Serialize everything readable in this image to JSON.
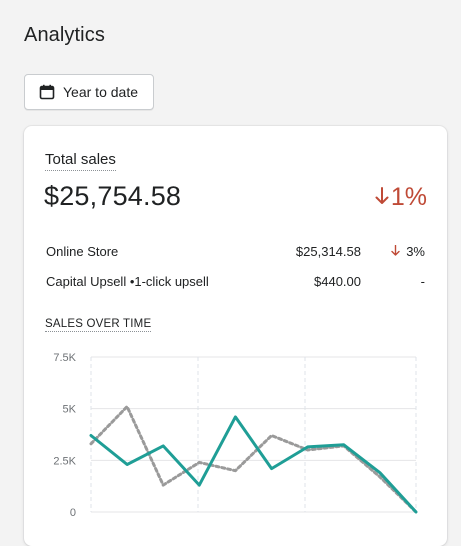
{
  "page": {
    "title": "Analytics",
    "date_button_label": "Year to date"
  },
  "card": {
    "title": "Total sales",
    "total_value": "$25,754.58",
    "total_change": "1%",
    "breakdown": [
      {
        "name": "Online Store",
        "amount": "$25,314.58",
        "change": "3%",
        "trend": "down"
      },
      {
        "name": "Capital Upsell •1-click upsell",
        "amount": "$440.00",
        "change": "-",
        "trend": "none"
      }
    ],
    "chart_title": "SALES OVER TIME"
  },
  "colors": {
    "accent_line": "#1f9e96",
    "comparison_line": "#9a9a9a",
    "negative": "#bf4a36"
  },
  "chart_data": {
    "type": "line",
    "title": "SALES OVER TIME",
    "xlabel": "",
    "ylabel": "",
    "ylim": [
      0,
      7500
    ],
    "yticks": [
      0,
      2500,
      5000,
      7500
    ],
    "ytick_labels": [
      "0",
      "2.5K",
      "5K",
      "7.5K"
    ],
    "grid": true,
    "series": [
      {
        "style": "solid",
        "values": [
          3700,
          2300,
          3200,
          1300,
          4600,
          2100,
          3150,
          3250,
          1900,
          0
        ]
      },
      {
        "style": "dotted",
        "values": [
          3300,
          5100,
          1300,
          2400,
          2000,
          3700,
          3000,
          3200,
          1700,
          0
        ]
      }
    ]
  }
}
